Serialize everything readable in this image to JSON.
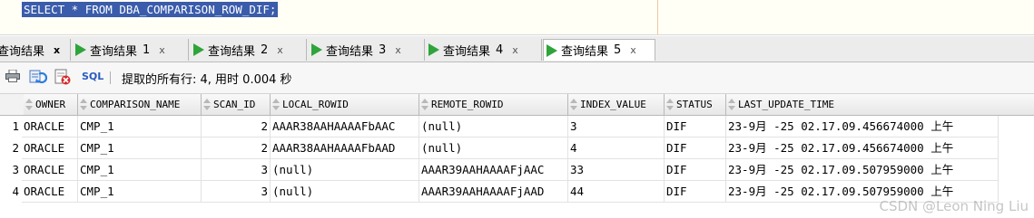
{
  "editor": {
    "sql": "SELECT * FROM DBA_COMPARISON_ROW_DIF;"
  },
  "tabs": [
    {
      "label": "查询结果",
      "num": "",
      "active": false,
      "close": "x"
    },
    {
      "label": "查询结果",
      "num": "1",
      "active": false,
      "close": "x"
    },
    {
      "label": "查询结果",
      "num": "2",
      "active": false,
      "close": "x"
    },
    {
      "label": "查询结果",
      "num": "3",
      "active": false,
      "close": "x"
    },
    {
      "label": "查询结果",
      "num": "4",
      "active": false,
      "close": "x"
    },
    {
      "label": "查询结果",
      "num": "5",
      "active": true,
      "close": "x"
    }
  ],
  "toolbar": {
    "sql_label": "SQL",
    "status": "提取的所有行: 4, 用时 0.004 秒"
  },
  "grid": {
    "columns": [
      "OWNER",
      "COMPARISON_NAME",
      "SCAN_ID",
      "LOCAL_ROWID",
      "REMOTE_ROWID",
      "INDEX_VALUE",
      "STATUS",
      "LAST_UPDATE_TIME"
    ],
    "rows": [
      {
        "n": "1",
        "cells": [
          "ORACLE",
          "CMP_1",
          "2",
          "AAAR38AAHAAAAFbAAC",
          "(null)",
          "3",
          "DIF",
          "23-9月 -25 02.17.09.456674000 上午"
        ]
      },
      {
        "n": "2",
        "cells": [
          "ORACLE",
          "CMP_1",
          "2",
          "AAAR38AAHAAAAFbAAD",
          "(null)",
          "4",
          "DIF",
          "23-9月 -25 02.17.09.456674000 上午"
        ]
      },
      {
        "n": "3",
        "cells": [
          "ORACLE",
          "CMP_1",
          "3",
          "(null)",
          "AAAR39AAHAAAAFjAAC",
          "33",
          "DIF",
          "23-9月 -25 02.17.09.507959000 上午"
        ]
      },
      {
        "n": "4",
        "cells": [
          "ORACLE",
          "CMP_1",
          "3",
          "(null)",
          "AAAR39AAHAAAAFjAAD",
          "44",
          "DIF",
          "23-9月 -25 02.17.09.507959000 上午"
        ]
      }
    ]
  },
  "watermark": "CSDN @Leon Ning Liu"
}
